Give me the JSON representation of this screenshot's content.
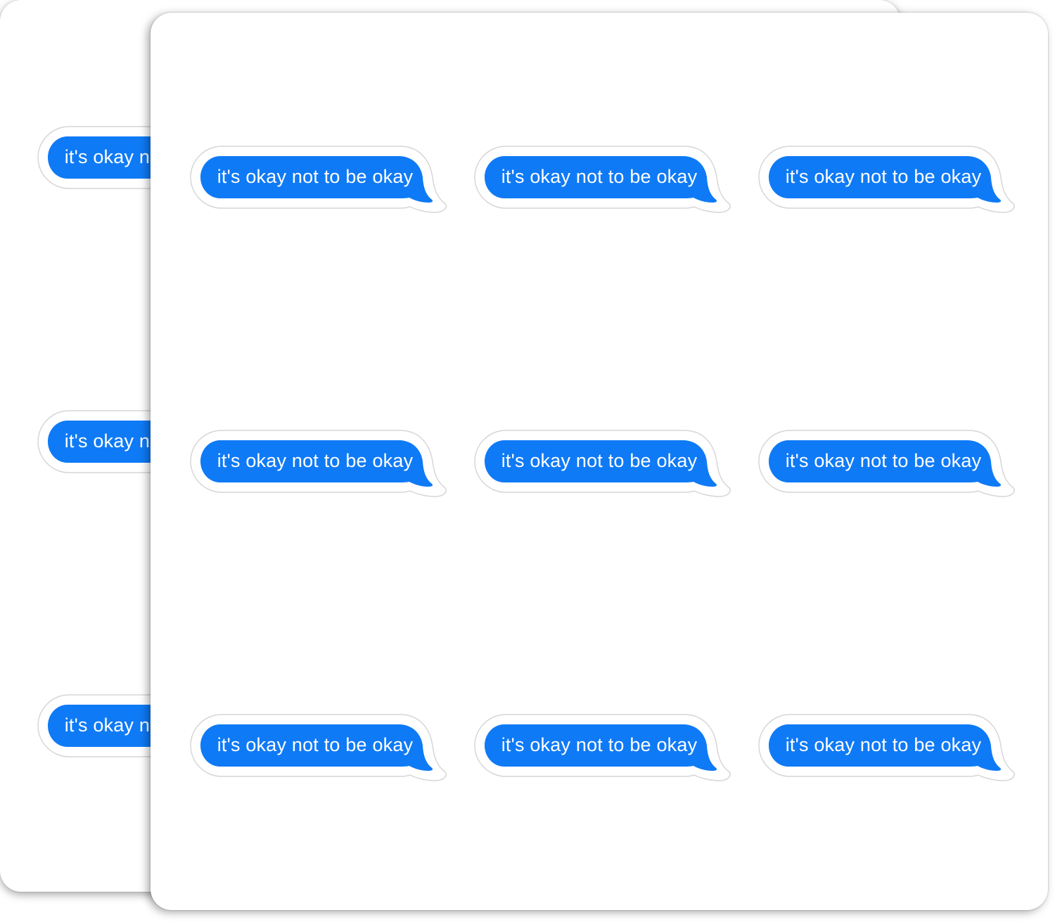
{
  "sticker_text": "it's okay not to be okay",
  "colors": {
    "bubble_blue": "#0f7af6",
    "sticker_border": "#ffffff",
    "sheet_background": "#ffffff"
  },
  "back_sheet": {
    "stickers": [
      {
        "text": "it's okay not to be okay"
      },
      {
        "text": "it's okay not to be okay"
      },
      {
        "text": "it's okay not to be okay"
      }
    ]
  },
  "front_sheet": {
    "stickers": [
      {
        "text": "it's okay not to be okay"
      },
      {
        "text": "it's okay not to be okay"
      },
      {
        "text": "it's okay not to be okay"
      },
      {
        "text": "it's okay not to be okay"
      },
      {
        "text": "it's okay not to be okay"
      },
      {
        "text": "it's okay not to be okay"
      },
      {
        "text": "it's okay not to be okay"
      },
      {
        "text": "it's okay not to be okay"
      },
      {
        "text": "it's okay not to be okay"
      }
    ]
  }
}
